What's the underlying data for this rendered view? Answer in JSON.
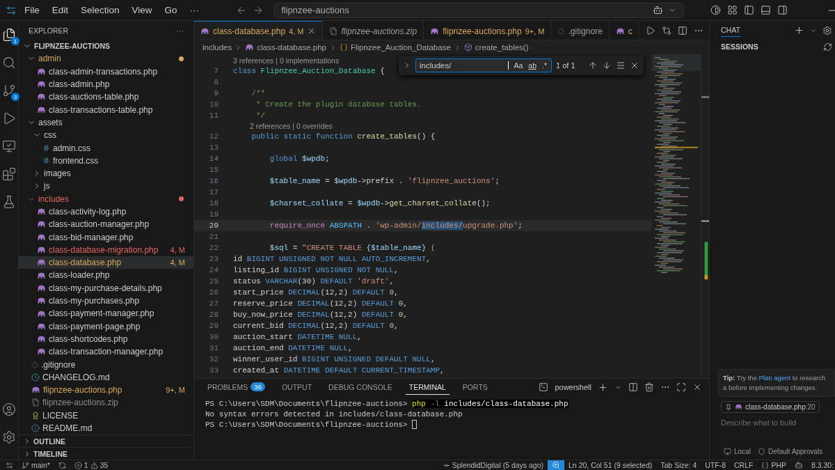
{
  "title_bar": {
    "menu": [
      "File",
      "Edit",
      "Selection",
      "View",
      "Go",
      "···"
    ],
    "command_center": "flipnzee-auctions"
  },
  "activity_bar": {
    "items": [
      {
        "kind": "explorer",
        "badge": "1",
        "selected": true
      },
      {
        "kind": "search",
        "selected": false
      },
      {
        "kind": "source-control",
        "badge": "3",
        "selected": false
      },
      {
        "kind": "run",
        "selected": false
      },
      {
        "kind": "remote",
        "selected": false
      },
      {
        "kind": "extensions",
        "selected": false
      },
      {
        "kind": "testing",
        "selected": false
      }
    ],
    "bottom": [
      {
        "kind": "accounts"
      },
      {
        "kind": "settings"
      }
    ]
  },
  "explorer": {
    "title": "EXPLORER",
    "more": "···",
    "root": {
      "name": "FLIPNZEE-AUCTIONS",
      "expanded": true,
      "children": [
        {
          "name": "admin",
          "kind": "folder",
          "expanded": true,
          "dot": true,
          "color": "#d7a95c",
          "selected": false,
          "children": [
            {
              "name": "class-admin-transactions.php",
              "kind": "php",
              "selected": false
            },
            {
              "name": "class-admin.php",
              "kind": "php",
              "selected": false
            },
            {
              "name": "class-auctions-table.php",
              "kind": "php",
              "selected": false
            },
            {
              "name": "class-transactions-table.php",
              "kind": "php",
              "selected": false
            }
          ]
        },
        {
          "name": "assets",
          "kind": "folder",
          "expanded": true,
          "dot": false,
          "selected": false,
          "children": [
            {
              "name": "css",
              "kind": "folder",
              "expanded": true,
              "dot": false,
              "selected": false,
              "children": [
                {
                  "name": "admin.css",
                  "kind": "css",
                  "selected": false
                },
                {
                  "name": "frontend.css",
                  "kind": "css",
                  "selected": false
                }
              ]
            },
            {
              "name": "images",
              "kind": "folder",
              "expanded": false,
              "dot": false,
              "selected": false
            },
            {
              "name": "js",
              "kind": "folder",
              "expanded": false,
              "dot": false,
              "selected": false
            }
          ]
        },
        {
          "name": "includes",
          "kind": "folder",
          "expanded": true,
          "dot": true,
          "color": "#e0665f",
          "selected": false,
          "children": [
            {
              "name": "class-activity-log.php",
              "kind": "php",
              "selected": false
            },
            {
              "name": "class-auction-manager.php",
              "kind": "php",
              "selected": false
            },
            {
              "name": "class-bid-manager.php",
              "kind": "php",
              "selected": false
            },
            {
              "name": "class-database-migration.php",
              "kind": "php",
              "status": "4, M",
              "color": "#e0665f",
              "selected": false
            },
            {
              "name": "class-database.php",
              "kind": "php",
              "status": "4, M",
              "color": "#d7a95c",
              "selected": true
            },
            {
              "name": "class-loader.php",
              "kind": "php",
              "selected": false
            },
            {
              "name": "class-my-purchase-details.php",
              "kind": "php",
              "selected": false
            },
            {
              "name": "class-my-purchases.php",
              "kind": "php",
              "selected": false
            },
            {
              "name": "class-payment-manager.php",
              "kind": "php",
              "selected": false
            },
            {
              "name": "class-payment-page.php",
              "kind": "php",
              "selected": false
            },
            {
              "name": "class-shortcodes.php",
              "kind": "php",
              "selected": false
            },
            {
              "name": "class-transaction-manager.php",
              "kind": "php",
              "selected": false
            }
          ]
        },
        {
          "name": ".gitignore",
          "kind": "git",
          "selected": false
        },
        {
          "name": "CHANGELOG.md",
          "kind": "changelog",
          "selected": false
        },
        {
          "name": "flipnzee-auctions.php",
          "kind": "php",
          "status": "9+, M",
          "color": "#d7a95c",
          "selected": false
        },
        {
          "name": "flipnzee-auctions.zip",
          "kind": "zip",
          "color": "#8c8c8c",
          "selected": false
        },
        {
          "name": "LICENSE",
          "kind": "license",
          "selected": false
        },
        {
          "name": "README.md",
          "kind": "readme",
          "selected": false
        }
      ]
    },
    "sections": [
      {
        "name": "OUTLINE",
        "expanded": false
      },
      {
        "name": "TIMELINE",
        "expanded": false
      }
    ]
  },
  "editor": {
    "tabs": [
      {
        "label": "class-database.php",
        "status": "4, M",
        "kind": "php",
        "selected": true,
        "preview": false,
        "modified": true
      },
      {
        "label": "flipnzee-auctions.zip",
        "kind": "zip",
        "selected": false,
        "preview": true,
        "modified": false
      },
      {
        "label": "flipnzee-auctions.php",
        "status": "9+, M",
        "kind": "php",
        "selected": false,
        "preview": false,
        "modified": true
      },
      {
        "label": ".gitignore",
        "kind": "git",
        "selected": false,
        "preview": false,
        "modified": false
      },
      {
        "label": "c",
        "kind": "php",
        "selected": false,
        "preview": false,
        "modified": true
      }
    ],
    "breadcrumb": [
      {
        "kind": "folder",
        "text": "includes"
      },
      {
        "kind": "php",
        "text": "class-database.php"
      },
      {
        "kind": "class",
        "text": "Flipnzee_Auction_Database"
      },
      {
        "kind": "method",
        "text": "create_tables()"
      }
    ],
    "lines": [
      {
        "number": "7",
        "current": false,
        "lens": "3 references | 0 implementations",
        "tokens": [
          {
            "kind": "keyword",
            "text": "class "
          },
          {
            "kind": "type",
            "text": "Flipnzee_Auction_Database"
          },
          {
            "kind": "plain",
            "text": " {"
          }
        ]
      },
      {
        "number": "8",
        "current": false
      },
      {
        "number": "9",
        "current": false,
        "tokens": [
          {
            "kind": "comment",
            "text": "    /**"
          }
        ]
      },
      {
        "number": "10",
        "current": false,
        "tokens": [
          {
            "kind": "comment",
            "text": "     * Create the plugin database tables."
          }
        ]
      },
      {
        "number": "11",
        "current": false,
        "tokens": [
          {
            "kind": "comment",
            "text": "     */"
          }
        ]
      },
      {
        "number": "12",
        "current": false,
        "lens": "2 references | 0 overrides",
        "tokens": [
          {
            "kind": "keyword",
            "text": "    public static function "
          },
          {
            "kind": "function",
            "text": "create_tables"
          },
          {
            "kind": "plain",
            "text": "() {"
          }
        ]
      },
      {
        "number": "13",
        "current": false
      },
      {
        "number": "14",
        "current": false,
        "tokens": [
          {
            "kind": "keyword",
            "text": "        global "
          },
          {
            "kind": "variable",
            "text": "$wpdb"
          },
          {
            "kind": "plain",
            "text": ";"
          }
        ]
      },
      {
        "number": "15",
        "current": false
      },
      {
        "number": "16",
        "current": false,
        "tokens": [
          {
            "kind": "variable",
            "text": "        $table_name"
          },
          {
            "kind": "plain",
            "text": " = "
          },
          {
            "kind": "variable",
            "text": "$wpdb"
          },
          {
            "kind": "plain",
            "text": "->prefix . "
          },
          {
            "kind": "string",
            "text": "'flipnzee_auctions'"
          },
          {
            "kind": "plain",
            "text": ";"
          }
        ]
      },
      {
        "number": "17",
        "current": false
      },
      {
        "number": "18",
        "current": false,
        "tokens": [
          {
            "kind": "variable",
            "text": "        $charset_collate"
          },
          {
            "kind": "plain",
            "text": " = "
          },
          {
            "kind": "variable",
            "text": "$wpdb"
          },
          {
            "kind": "plain",
            "text": "->"
          },
          {
            "kind": "function",
            "text": "get_charset_collate"
          },
          {
            "kind": "plain",
            "text": "();"
          }
        ]
      },
      {
        "number": "19",
        "current": false
      },
      {
        "number": "20",
        "current": true,
        "tokens": [
          {
            "kind": "control",
            "text": "        require_once "
          },
          {
            "kind": "constant",
            "text": "ABSPATH"
          },
          {
            "kind": "plain",
            "text": " . "
          },
          {
            "kind": "string",
            "text": "'wp-admin/"
          },
          {
            "kind": "match",
            "text": "includes/"
          },
          {
            "kind": "string",
            "text": "upgrade.php'"
          },
          {
            "kind": "plain",
            "text": ";"
          }
        ]
      },
      {
        "number": "21",
        "current": false
      },
      {
        "number": "22",
        "current": false,
        "tokens": [
          {
            "kind": "variable",
            "text": "        $sql"
          },
          {
            "kind": "plain",
            "text": " = "
          },
          {
            "kind": "string",
            "text": "\"CREATE TABLE "
          },
          {
            "kind": "variable",
            "text": "{$table_name}"
          },
          {
            "kind": "string",
            "text": " ("
          }
        ]
      },
      {
        "number": "23",
        "current": false,
        "tokens": [
          {
            "kind": "plain",
            "text": "id "
          },
          {
            "kind": "sql",
            "text": "BIGINT UNSIGNED NOT NULL AUTO_INCREMENT"
          },
          {
            "kind": "plain",
            "text": ","
          }
        ]
      },
      {
        "number": "24",
        "current": false,
        "tokens": [
          {
            "kind": "plain",
            "text": "listing_id "
          },
          {
            "kind": "sql",
            "text": "BIGINT UNSIGNED NOT NULL"
          },
          {
            "kind": "plain",
            "text": ","
          }
        ]
      },
      {
        "number": "25",
        "current": false,
        "tokens": [
          {
            "kind": "plain",
            "text": "status "
          },
          {
            "kind": "sql",
            "text": "VARCHAR"
          },
          {
            "kind": "plain",
            "text": "(30) "
          },
          {
            "kind": "sql",
            "text": "DEFAULT "
          },
          {
            "kind": "string",
            "text": "'draft'"
          },
          {
            "kind": "plain",
            "text": ","
          }
        ]
      },
      {
        "number": "26",
        "current": false,
        "tokens": [
          {
            "kind": "plain",
            "text": "start_price "
          },
          {
            "kind": "sql",
            "text": "DECIMAL"
          },
          {
            "kind": "plain",
            "text": "(12,2) "
          },
          {
            "kind": "sql",
            "text": "DEFAULT "
          },
          {
            "kind": "number",
            "text": "0"
          },
          {
            "kind": "plain",
            "text": ","
          }
        ]
      },
      {
        "number": "27",
        "current": false,
        "tokens": [
          {
            "kind": "plain",
            "text": "reserve_price "
          },
          {
            "kind": "sql",
            "text": "DECIMAL"
          },
          {
            "kind": "plain",
            "text": "(12,2) "
          },
          {
            "kind": "sql",
            "text": "DEFAULT "
          },
          {
            "kind": "number",
            "text": "0"
          },
          {
            "kind": "plain",
            "text": ","
          }
        ]
      },
      {
        "number": "28",
        "current": false,
        "tokens": [
          {
            "kind": "plain",
            "text": "buy_now_price "
          },
          {
            "kind": "sql",
            "text": "DECIMAL"
          },
          {
            "kind": "plain",
            "text": "(12,2) "
          },
          {
            "kind": "sql",
            "text": "DEFAULT "
          },
          {
            "kind": "number",
            "text": "0"
          },
          {
            "kind": "plain",
            "text": ","
          }
        ]
      },
      {
        "number": "29",
        "current": false,
        "tokens": [
          {
            "kind": "plain",
            "text": "current_bid "
          },
          {
            "kind": "sql",
            "text": "DECIMAL"
          },
          {
            "kind": "plain",
            "text": "(12,2) "
          },
          {
            "kind": "sql",
            "text": "DEFAULT "
          },
          {
            "kind": "number",
            "text": "0"
          },
          {
            "kind": "plain",
            "text": ","
          }
        ]
      },
      {
        "number": "30",
        "current": false,
        "tokens": [
          {
            "kind": "plain",
            "text": "auction_start "
          },
          {
            "kind": "sql",
            "text": "DATETIME NULL"
          },
          {
            "kind": "plain",
            "text": ","
          }
        ]
      },
      {
        "number": "31",
        "current": false,
        "tokens": [
          {
            "kind": "plain",
            "text": "auction_end "
          },
          {
            "kind": "sql",
            "text": "DATETIME NULL"
          },
          {
            "kind": "plain",
            "text": ","
          }
        ]
      },
      {
        "number": "32",
        "current": false,
        "tokens": [
          {
            "kind": "plain",
            "text": "winner_user_id "
          },
          {
            "kind": "sql",
            "text": "BIGINT UNSIGNED DEFAULT NULL"
          },
          {
            "kind": "plain",
            "text": ","
          }
        ]
      },
      {
        "number": "33",
        "current": false,
        "tokens": [
          {
            "kind": "plain",
            "text": "created_at "
          },
          {
            "kind": "sql",
            "text": "DATETIME DEFAULT CURRENT_TIMESTAMP"
          },
          {
            "kind": "plain",
            "text": ","
          }
        ]
      }
    ],
    "find": {
      "value": "includes/",
      "toggles": [
        {
          "label": "Aa",
          "on": false
        },
        {
          "label": "ab",
          "on": false
        },
        {
          "label": ".*",
          "on": false
        }
      ],
      "result": "1 of 1"
    }
  },
  "panel": {
    "tabs": [
      {
        "label": "PROBLEMS",
        "badge": "36",
        "selected": false
      },
      {
        "label": "OUTPUT",
        "selected": false
      },
      {
        "label": "DEBUG CONSOLE",
        "selected": false
      },
      {
        "label": "TERMINAL",
        "selected": true
      },
      {
        "label": "PORTS",
        "selected": false
      }
    ],
    "shell": "powershell",
    "lines": [
      {
        "cursor": false,
        "tokens": [
          {
            "kind": "prompt",
            "text": "PS C:\\Users\\SDM\\Documents\\flipnzee-auctions> "
          },
          {
            "kind": "command",
            "text": "php"
          },
          {
            "kind": "flag",
            "text": " -l "
          },
          {
            "kind": "arg",
            "text": "includes/class-database.php"
          }
        ]
      },
      {
        "cursor": false,
        "tokens": [
          {
            "kind": "output",
            "text": "No syntax errors detected in includes/class-database.php"
          }
        ]
      },
      {
        "cursor": true,
        "tokens": [
          {
            "kind": "prompt",
            "text": "PS C:\\Users\\SDM\\Documents\\flipnzee-auctions> "
          }
        ]
      }
    ]
  },
  "chat": {
    "tabs": [
      {
        "label": "CHAT",
        "selected": true
      }
    ],
    "section": "SESSIONS",
    "tip": {
      "label": "Tip:",
      "lead": "Try the",
      "link": "Plan agent",
      "tail": "to research a",
      "continuation": "before implementing changes."
    },
    "context": {
      "file": "class-database.php",
      "line": ":20"
    },
    "input": {
      "placeholder": "Describe what to build"
    },
    "footer": [
      {
        "kind": "local",
        "text": "Local"
      },
      {
        "kind": "approvals",
        "text": "Default Approvals"
      }
    ]
  },
  "status_bar": {
    "left": [
      {
        "kind": "remote"
      },
      {
        "kind": "branch",
        "text": "main*"
      },
      {
        "kind": "sync"
      },
      {
        "kind": "problems",
        "errors": "1",
        "warnings": "35"
      }
    ],
    "right": [
      {
        "kind": "blame",
        "text": "SplendidDigital (5 days ago)"
      },
      {
        "kind": "zoom"
      },
      {
        "kind": "text",
        "text": "Ln 20, Col 51 (9 selected)"
      },
      {
        "kind": "text",
        "text": "Tab Size: 4"
      },
      {
        "kind": "text",
        "text": "UTF-8"
      },
      {
        "kind": "text",
        "text": "CRLF"
      },
      {
        "kind": "language",
        "text": "PHP"
      },
      {
        "kind": "copilot"
      },
      {
        "kind": "text",
        "text": "8.3.30:"
      }
    ]
  }
}
